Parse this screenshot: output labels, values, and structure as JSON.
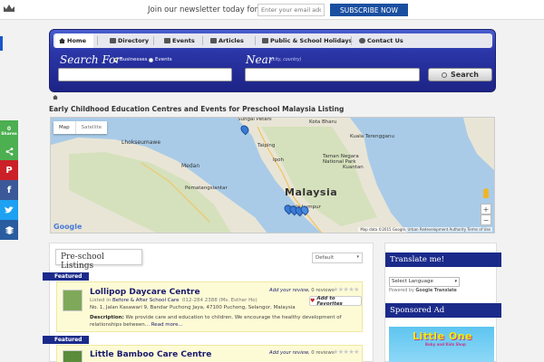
{
  "newsletter": {
    "text": "Join our newsletter today for free.",
    "email_placeholder": "Enter your email addre",
    "subscribe_label": "SUBSCRIBE NOW"
  },
  "nav": {
    "items": [
      {
        "label": "Home",
        "icon": "home-icon",
        "active": true
      },
      {
        "label": "Directory",
        "icon": "book-icon"
      },
      {
        "label": "Events",
        "icon": "calendar-icon"
      },
      {
        "label": "Articles",
        "icon": "newspaper-icon"
      },
      {
        "label": "Public & School Holidays",
        "icon": "calendar-icon"
      },
      {
        "label": "Contact Us",
        "icon": "chat-icon"
      }
    ]
  },
  "search": {
    "search_for_label": "Search For",
    "radio_businesses": "Businesses",
    "radio_events": "Events",
    "near_label": "Near",
    "near_hint": "(city, country)",
    "button_label": "Search"
  },
  "page": {
    "title": "Early Childhood Education Centres and Events for Preschool Malaysia Listing"
  },
  "map": {
    "tab_map": "Map",
    "tab_satellite": "Satellite",
    "country_label": "Malaysia",
    "place_labels": {
      "lhokseumawe": "Lhokseumawe",
      "medan": "Medan",
      "pematangsiantar": "Pematangsiantar",
      "sungai_petani": "Sungai Petani",
      "ipoh": "Ipoh",
      "taiping": "Taiping",
      "kuala_lumpur": "Kuala Lumpur",
      "taman_negara": "Taman Negara National Park",
      "kuala_terengganu": "Kuala Terengganu",
      "kuantan": "Kuantan",
      "kota_bharu": "Kota Bharu"
    },
    "google": "Google",
    "copyright": "Map data ©2015 Google, Urban Redevelopment Authority   Terms of Use",
    "zoom_in": "+",
    "zoom_out": "−"
  },
  "share": {
    "count_label": "Shares",
    "count_value": "0",
    "colors": {
      "facebook": "#3b5998",
      "pinterest": "#cb2027",
      "twitter": "#1da1f2",
      "buffer": "#2a5d9f",
      "count": "#4caf50"
    }
  },
  "listings": {
    "header": "Pre-school Listings",
    "sort_default": "Default",
    "featured_label": "Featured",
    "items": [
      {
        "title": "Lollipop Daycare Centre",
        "listed_in": "Listed in",
        "category": "Before & After School Care",
        "phone": "012-284 2388 (Ms. Esther Ho)",
        "address": "No. 1, Jalan Kasawari 9, Bandar Puchong Jaya, 47100 Puchong, Selangor, Malaysia",
        "description_label": "Description:",
        "description": "We provide care and education to children. We encourage the healthy development of relationships between...",
        "read_more": "Read more...",
        "add_review": "Add your review,",
        "reviews": "0 reviews",
        "favorite_label": "Add to Favorites"
      },
      {
        "title": "Little Bamboo Care Centre",
        "add_review": "Add your review,",
        "reviews": "0 reviews"
      }
    ]
  },
  "sidebar": {
    "translate_title": "Translate me!",
    "language_select": "Select Language",
    "powered_by": "Powered by",
    "powered_brand": "Google",
    "translate_word": "Translate",
    "sponsored_title": "Sponsored Ad",
    "ad_text": "Little One",
    "ad_sub": "Baby and Kids Shop"
  }
}
